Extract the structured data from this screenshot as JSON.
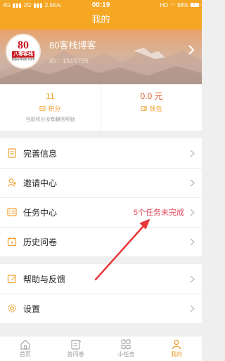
{
  "statusbar": {
    "left": "4G",
    "signal2": "2G",
    "speed": "2.5K/s",
    "time": "00:19",
    "hd": "HD",
    "battery": "88%"
  },
  "navbar": {
    "title": "我的"
  },
  "profile": {
    "name": "80客栈博客",
    "id": "ID：1515755",
    "avatar_num": "80",
    "avatar_cn": "八零客栈",
    "avatar_domain": "80kezhan.com"
  },
  "stats": {
    "points_value": "11",
    "points_label": "积分",
    "points_note": "当前积分没有翻倍奖励",
    "wallet_value": "0.0 元",
    "wallet_label": "钱包"
  },
  "menu1": [
    {
      "label": "完善信息",
      "icon": "profile-form-icon"
    },
    {
      "label": "邀请中心",
      "icon": "invite-user-icon"
    },
    {
      "label": "任务中心",
      "icon": "task-list-icon",
      "extra": "5个任务未完成"
    },
    {
      "label": "历史问卷",
      "icon": "calendar-history-icon"
    }
  ],
  "menu2": [
    {
      "label": "帮助与反馈",
      "icon": "edit-feedback-icon"
    },
    {
      "label": "设置",
      "icon": "gear-icon"
    }
  ],
  "tabs": [
    {
      "label": "首页",
      "icon": "home-icon"
    },
    {
      "label": "答问卷",
      "icon": "questionnaire-icon"
    },
    {
      "label": "小任务",
      "icon": "grid-tasks-icon"
    },
    {
      "label": "我的",
      "icon": "person-icon",
      "active": true
    }
  ],
  "colors": {
    "accent": "#f5a623",
    "alert": "#e0475a",
    "arrow": "#e8373a"
  }
}
